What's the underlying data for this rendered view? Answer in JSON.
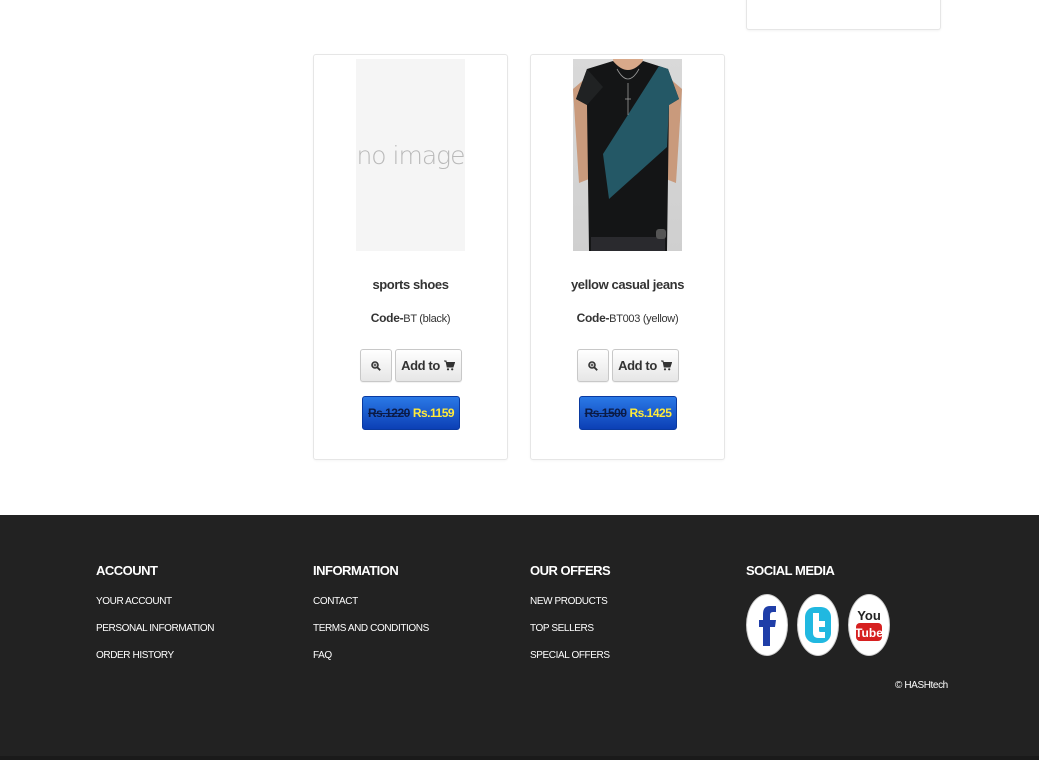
{
  "products": [
    {
      "title": "sports shoes",
      "code_label": "Code-",
      "code_value": "BT (black)",
      "image_placeholder": "no image",
      "add_label": "Add to",
      "old_price": "Rs.1220",
      "new_price": "Rs.1159"
    },
    {
      "title": "yellow casual jeans",
      "code_label": "Code-",
      "code_value": "BT003 (yellow)",
      "add_label": "Add to",
      "old_price": "Rs.1500",
      "new_price": "Rs.1425"
    }
  ],
  "footer": {
    "account": {
      "heading": "ACCOUNT",
      "links": [
        "YOUR ACCOUNT",
        "PERSONAL INFORMATION",
        "ORDER HISTORY"
      ]
    },
    "information": {
      "heading": "INFORMATION",
      "links": [
        "CONTACT",
        "TERMS AND CONDITIONS",
        "FAQ"
      ]
    },
    "offers": {
      "heading": "OUR OFFERS",
      "links": [
        "NEW PRODUCTS",
        "TOP SELLERS",
        "SPECIAL OFFERS"
      ]
    },
    "social": {
      "heading": "SOCIAL MEDIA",
      "icons": [
        "facebook-icon",
        "twitter-icon",
        "youtube-icon"
      ],
      "youtube_text_top": "You",
      "youtube_text_bottom": "Tube"
    },
    "copyright": "© HASHtech"
  },
  "colors": {
    "price_button": "#1a56d6",
    "new_price": "#ffea3a",
    "footer_bg": "#222222"
  }
}
